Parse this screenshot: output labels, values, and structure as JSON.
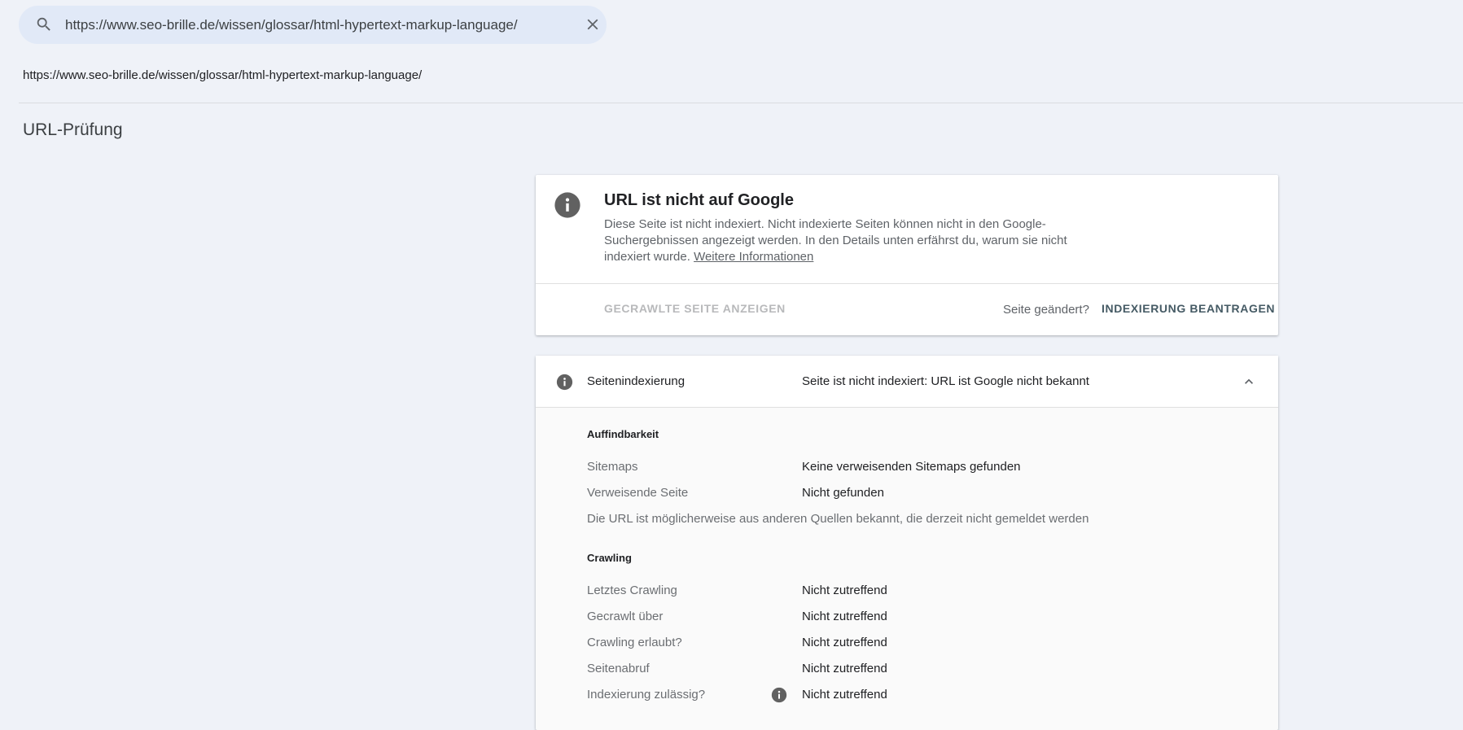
{
  "search": {
    "value": "https://www.seo-brille.de/wissen/glossar/html-hypertext-markup-language/"
  },
  "inspected_url": "https://www.seo-brille.de/wissen/glossar/html-hypertext-markup-language/",
  "page_title": "URL-Prüfung",
  "status_card": {
    "title": "URL ist nicht auf Google",
    "description": "Diese Seite ist nicht indexiert. Nicht indexierte Seiten können nicht in den Google-Suchergebnissen angezeigt werden. In den Details unten erfährst du, warum sie nicht indexiert wurde.",
    "more_info_link": "Weitere Informationen",
    "view_crawled_button": "GECRAWLTE SEITE ANZEIGEN",
    "page_changed_question": "Seite geändert?",
    "request_indexing_button": "INDEXIERUNG BEANTRAGEN"
  },
  "indexing_card": {
    "header_label": "Seitenindexierung",
    "header_value": "Seite ist nicht indexiert: URL ist Google nicht bekannt",
    "discovery": {
      "title": "Auffindbarkeit",
      "rows": [
        {
          "label": "Sitemaps",
          "value": "Keine verweisenden Sitemaps gefunden"
        },
        {
          "label": "Verweisende Seite",
          "value": "Nicht gefunden"
        }
      ],
      "note": "Die URL ist möglicherweise aus anderen Quellen bekannt, die derzeit nicht gemeldet werden"
    },
    "crawling": {
      "title": "Crawling",
      "rows": [
        {
          "label": "Letztes Crawling",
          "value": "Nicht zutreffend"
        },
        {
          "label": "Gecrawlt über",
          "value": "Nicht zutreffend"
        },
        {
          "label": "Crawling erlaubt?",
          "value": "Nicht zutreffend"
        },
        {
          "label": "Seitenabruf",
          "value": "Nicht zutreffend"
        },
        {
          "label": "Indexierung zulässig?",
          "value": "Nicht zutreffend"
        }
      ]
    }
  },
  "colors": {
    "page_bg": "#eff2f8",
    "search_bg": "#e1e9f7",
    "info_icon": "#616161",
    "accent_button": "#455a64"
  },
  "icons": [
    "search-icon",
    "close-icon",
    "info-icon",
    "chevron-up-icon"
  ]
}
